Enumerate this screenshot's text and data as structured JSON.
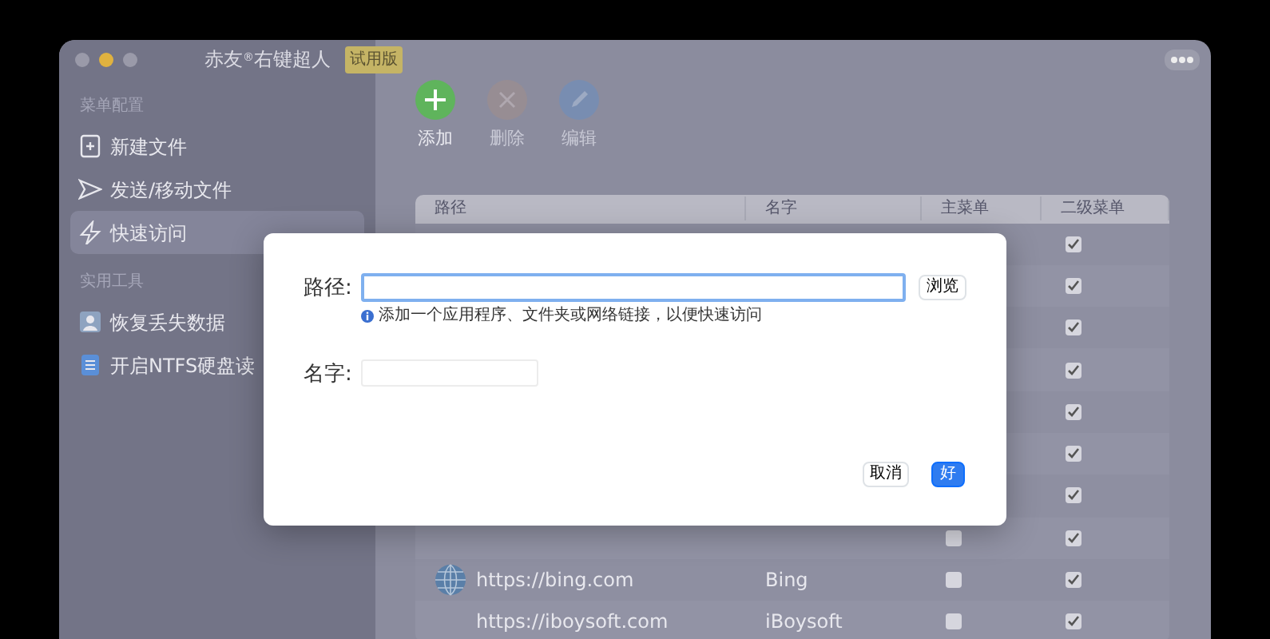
{
  "window": {
    "title": "赤友$^{®}$右键超人",
    "badge": "试用版"
  },
  "sidebar": {
    "sections": [
      {
        "header": "菜单配置",
        "items": [
          {
            "label": "新建文件",
            "selected": false
          },
          {
            "label": "发送/移动文件",
            "selected": false
          },
          {
            "label": "快速访问",
            "selected": true
          }
        ]
      },
      {
        "header": "实用工具",
        "items": [
          {
            "label": "恢复丢失数据",
            "selected": false
          },
          {
            "label": "开启NTFS硬盘读",
            "selected": false
          }
        ]
      }
    ]
  },
  "toolbar": [
    {
      "label": "添加",
      "kind": "add",
      "disabled": false
    },
    {
      "label": "删除",
      "kind": "delete",
      "disabled": true
    },
    {
      "label": "编辑",
      "kind": "edit",
      "disabled": true
    }
  ],
  "table": {
    "columns": [
      "路径",
      "名字",
      "主菜单",
      "二级菜单"
    ],
    "rows": [
      {
        "secondary": true
      },
      {
        "secondary": true
      },
      {
        "secondary": true
      },
      {
        "secondary": true
      },
      {
        "secondary": true
      },
      {
        "secondary": true
      },
      {
        "secondary": true
      },
      {
        "main": false,
        "secondary": true
      },
      {
        "path": "https://bing.com",
        "name": "Bing",
        "main": false,
        "secondary": true
      },
      {
        "path": "https://iboysoft.com",
        "name": "iBoysoft",
        "main": false,
        "secondary": true
      }
    ]
  },
  "dialog": {
    "path_label": "路径:",
    "path_hint": "添加一个应用程序、文件夹或网络链接，以便快速访问",
    "browse": "浏览",
    "name_label": "名字:",
    "cancel": "取消",
    "ok": "好"
  }
}
